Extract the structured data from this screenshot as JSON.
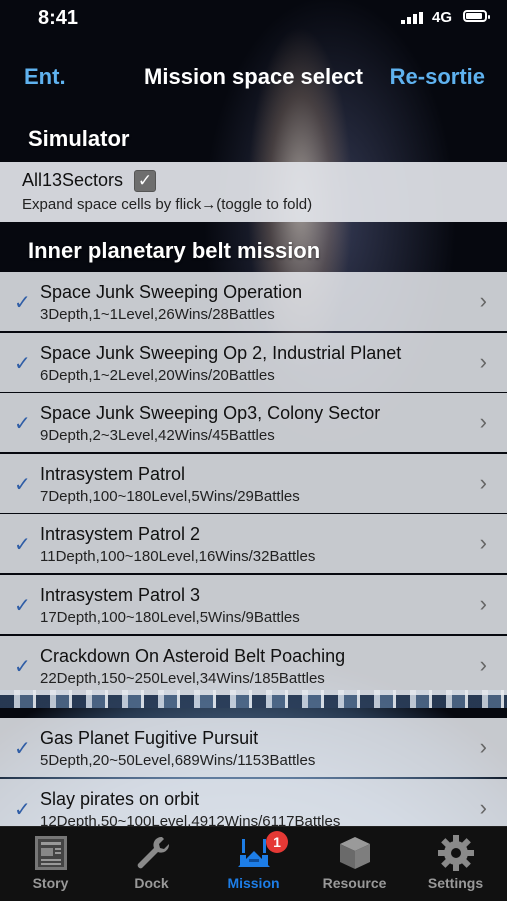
{
  "status": {
    "time": "8:41",
    "network": "4G"
  },
  "nav": {
    "left": "Ent.",
    "title": "Mission space select",
    "right": "Re-sortie"
  },
  "simulator": {
    "header": "Simulator",
    "label": "All13Sectors",
    "checked": true,
    "hint": "Expand space cells by flick→(toggle to fold)"
  },
  "section": {
    "header": "Inner planetary belt mission"
  },
  "missions_group1": [
    {
      "title": "Space Junk Sweeping Operation",
      "sub": "3Depth,1~1Level,26Wins/28Battles"
    },
    {
      "title": "Space Junk Sweeping Op 2, Industrial Planet",
      "sub": "6Depth,1~2Level,20Wins/20Battles"
    },
    {
      "title": "Space Junk Sweeping Op3, Colony Sector",
      "sub": "9Depth,2~3Level,42Wins/45Battles"
    },
    {
      "title": "Intrasystem Patrol",
      "sub": "7Depth,100~180Level,5Wins/29Battles"
    },
    {
      "title": "Intrasystem Patrol 2",
      "sub": "11Depth,100~180Level,16Wins/32Battles"
    },
    {
      "title": "Intrasystem Patrol 3",
      "sub": "17Depth,100~180Level,5Wins/9Battles"
    },
    {
      "title": "Crackdown On Asteroid Belt Poaching",
      "sub": "22Depth,150~250Level,34Wins/185Battles"
    }
  ],
  "missions_group2": [
    {
      "title": "Gas Planet Fugitive Pursuit",
      "sub": "5Depth,20~50Level,689Wins/1153Battles"
    },
    {
      "title": "Slay pirates on orbit",
      "sub": "12Depth,50~100Level,4912Wins/6117Battles"
    }
  ],
  "tabs": [
    {
      "label": "Story",
      "icon": "story-icon"
    },
    {
      "label": "Dock",
      "icon": "wrench-icon"
    },
    {
      "label": "Mission",
      "icon": "mission-icon",
      "badge": "1",
      "active": true
    },
    {
      "label": "Resource",
      "icon": "cube-icon"
    },
    {
      "label": "Settings",
      "icon": "gear-icon"
    }
  ],
  "colors": {
    "accent": "#5fb2ef",
    "active_tab": "#1d7de6",
    "check": "#2f5da6",
    "badge": "#e53935"
  }
}
